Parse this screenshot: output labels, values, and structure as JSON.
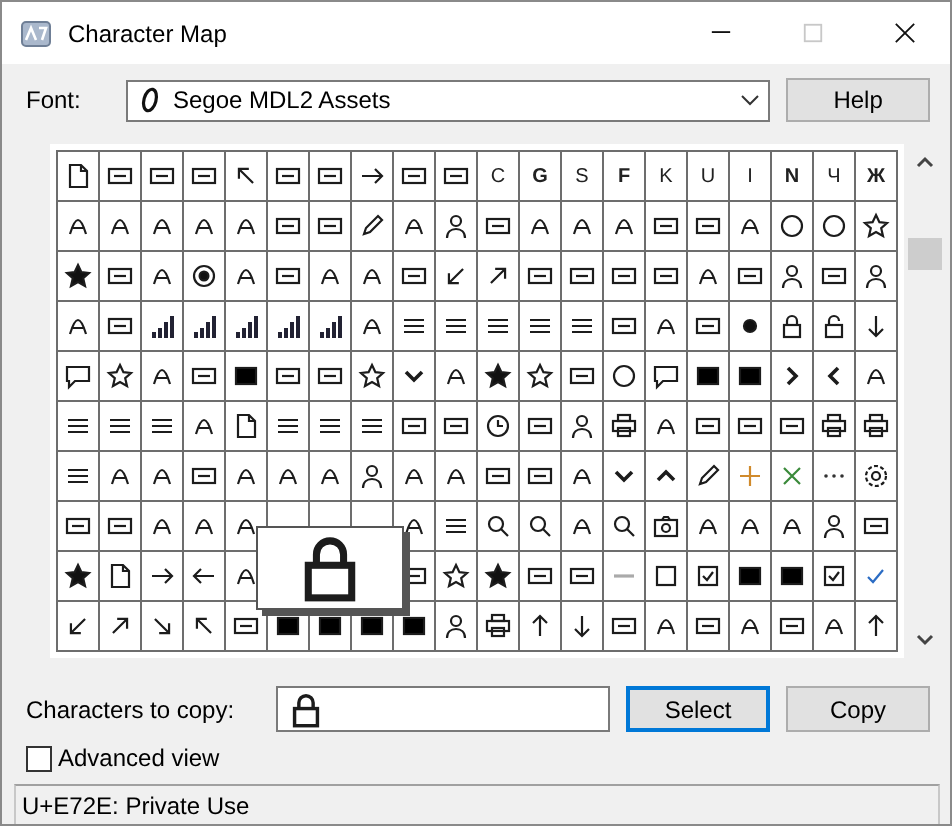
{
  "window": {
    "title": "Character Map"
  },
  "title_buttons": [
    {
      "kind": "minimize",
      "disabled": false
    },
    {
      "kind": "maximize",
      "disabled": true
    },
    {
      "kind": "close",
      "disabled": false
    }
  ],
  "font": {
    "label": "Font:",
    "value": "Segoe MDL2 Assets"
  },
  "help_button": "Help",
  "grid": {
    "rows": [
      [
        {
          "kind": "doc"
        },
        {
          "kind": "card"
        },
        {
          "kind": "card"
        },
        {
          "kind": "card"
        },
        {
          "kind": "arrow-nw"
        },
        {
          "kind": "card"
        },
        {
          "kind": "card"
        },
        {
          "kind": "arrow-e"
        },
        {
          "kind": "card"
        },
        {
          "kind": "card"
        },
        {
          "kind": "letter",
          "text": "C",
          "bold": false
        },
        {
          "kind": "letter",
          "text": "G",
          "bold": true
        },
        {
          "kind": "letter",
          "text": "S",
          "bold": false
        },
        {
          "kind": "letter",
          "text": "F",
          "bold": true
        },
        {
          "kind": "letter",
          "text": "K",
          "bold": false
        },
        {
          "kind": "letter",
          "text": "U",
          "bold": false
        },
        {
          "kind": "letter",
          "text": "I",
          "bold": false
        },
        {
          "kind": "letter",
          "text": "N",
          "bold": true
        },
        {
          "kind": "letter",
          "text": "Ч",
          "bold": false
        },
        {
          "kind": "letter",
          "text": "Ж",
          "bold": true
        }
      ],
      [
        {
          "kind": "glyph"
        },
        {
          "kind": "glyph"
        },
        {
          "kind": "glyph"
        },
        {
          "kind": "glyph"
        },
        {
          "kind": "glyph"
        },
        {
          "kind": "card"
        },
        {
          "kind": "card"
        },
        {
          "kind": "pencil"
        },
        {
          "kind": "glyph"
        },
        {
          "kind": "person"
        },
        {
          "kind": "card"
        },
        {
          "kind": "glyph"
        },
        {
          "kind": "glyph"
        },
        {
          "kind": "glyph"
        },
        {
          "kind": "card"
        },
        {
          "kind": "card"
        },
        {
          "kind": "glyph"
        },
        {
          "kind": "circle"
        },
        {
          "kind": "circle"
        },
        {
          "kind": "star-outline"
        }
      ],
      [
        {
          "kind": "star"
        },
        {
          "kind": "card"
        },
        {
          "kind": "glyph"
        },
        {
          "kind": "circle-dot"
        },
        {
          "kind": "glyph"
        },
        {
          "kind": "card"
        },
        {
          "kind": "glyph"
        },
        {
          "kind": "glyph"
        },
        {
          "kind": "card"
        },
        {
          "kind": "arrow-sw"
        },
        {
          "kind": "arrow-ne"
        },
        {
          "kind": "card"
        },
        {
          "kind": "card"
        },
        {
          "kind": "card"
        },
        {
          "kind": "card"
        },
        {
          "kind": "glyph"
        },
        {
          "kind": "card"
        },
        {
          "kind": "person"
        },
        {
          "kind": "card"
        },
        {
          "kind": "person"
        }
      ],
      [
        {
          "kind": "glyph"
        },
        {
          "kind": "card"
        },
        {
          "kind": "bars"
        },
        {
          "kind": "bars"
        },
        {
          "kind": "bars"
        },
        {
          "kind": "bars"
        },
        {
          "kind": "bars"
        },
        {
          "kind": "glyph"
        },
        {
          "kind": "lines"
        },
        {
          "kind": "lines"
        },
        {
          "kind": "lines"
        },
        {
          "kind": "lines"
        },
        {
          "kind": "lines"
        },
        {
          "kind": "card"
        },
        {
          "kind": "glyph"
        },
        {
          "kind": "card"
        },
        {
          "kind": "dot"
        },
        {
          "kind": "lock"
        },
        {
          "kind": "unlock"
        },
        {
          "kind": "arrow-s"
        }
      ],
      [
        {
          "kind": "speech"
        },
        {
          "kind": "star-outline"
        },
        {
          "kind": "glyph"
        },
        {
          "kind": "card"
        },
        {
          "kind": "square"
        },
        {
          "kind": "card"
        },
        {
          "kind": "card"
        },
        {
          "kind": "star-outline"
        },
        {
          "kind": "chevron-s"
        },
        {
          "kind": "glyph"
        },
        {
          "kind": "star"
        },
        {
          "kind": "star-outline"
        },
        {
          "kind": "card"
        },
        {
          "kind": "circle"
        },
        {
          "kind": "speech"
        },
        {
          "kind": "square"
        },
        {
          "kind": "square"
        },
        {
          "kind": "chevron-e"
        },
        {
          "kind": "chevron-w"
        },
        {
          "kind": "glyph"
        }
      ],
      [
        {
          "kind": "lines"
        },
        {
          "kind": "lines"
        },
        {
          "kind": "lines"
        },
        {
          "kind": "glyph"
        },
        {
          "kind": "doc"
        },
        {
          "kind": "lines"
        },
        {
          "kind": "lines"
        },
        {
          "kind": "lines"
        },
        {
          "kind": "card"
        },
        {
          "kind": "card"
        },
        {
          "kind": "clock"
        },
        {
          "kind": "card"
        },
        {
          "kind": "person"
        },
        {
          "kind": "printer"
        },
        {
          "kind": "glyph"
        },
        {
          "kind": "card"
        },
        {
          "kind": "card"
        },
        {
          "kind": "card"
        },
        {
          "kind": "printer"
        },
        {
          "kind": "printer"
        }
      ],
      [
        {
          "kind": "lines"
        },
        {
          "kind": "glyph"
        },
        {
          "kind": "glyph"
        },
        {
          "kind": "card"
        },
        {
          "kind": "glyph"
        },
        {
          "kind": "glyph"
        },
        {
          "kind": "glyph"
        },
        {
          "kind": "person"
        },
        {
          "kind": "glyph"
        },
        {
          "kind": "glyph"
        },
        {
          "kind": "card"
        },
        {
          "kind": "card"
        },
        {
          "kind": "glyph"
        },
        {
          "kind": "chevron-s"
        },
        {
          "kind": "chevron-n"
        },
        {
          "kind": "pencil"
        },
        {
          "kind": "plus"
        },
        {
          "kind": "cross"
        },
        {
          "kind": "dots"
        },
        {
          "kind": "gear"
        }
      ],
      [
        {
          "kind": "card"
        },
        {
          "kind": "card"
        },
        {
          "kind": "glyph"
        },
        {
          "kind": "glyph"
        },
        {
          "kind": "glyph"
        },
        {},
        {},
        {},
        {
          "kind": "glyph"
        },
        {
          "kind": "lines"
        },
        {
          "kind": "search"
        },
        {
          "kind": "search"
        },
        {
          "kind": "glyph"
        },
        {
          "kind": "search"
        },
        {
          "kind": "camera"
        },
        {
          "kind": "glyph"
        },
        {
          "kind": "glyph"
        },
        {
          "kind": "glyph"
        },
        {
          "kind": "person"
        },
        {
          "kind": "card"
        }
      ],
      [
        {
          "kind": "star"
        },
        {
          "kind": "doc"
        },
        {
          "kind": "arrow-e"
        },
        {
          "kind": "arrow-w"
        },
        {
          "kind": "glyph"
        },
        null,
        null,
        null,
        {
          "kind": "card"
        },
        {
          "kind": "star-outline"
        },
        {
          "kind": "star"
        },
        {
          "kind": "card"
        },
        {
          "kind": "card"
        },
        {
          "kind": "line"
        },
        {
          "kind": "square-outline"
        },
        {
          "kind": "checkbox"
        },
        {
          "kind": "square"
        },
        {
          "kind": "square"
        },
        {
          "kind": "checkbox"
        },
        {
          "kind": "check"
        }
      ],
      [
        {
          "kind": "arrow-sw"
        },
        {
          "kind": "arrow-ne"
        },
        {
          "kind": "arrow-se"
        },
        {
          "kind": "arrow-nw"
        },
        {
          "kind": "card"
        },
        {
          "kind": "square"
        },
        {
          "kind": "square"
        },
        {
          "kind": "square"
        },
        {
          "kind": "square"
        },
        {
          "kind": "person"
        },
        {
          "kind": "printer"
        },
        {
          "kind": "arrow-n"
        },
        {
          "kind": "arrow-s"
        },
        {
          "kind": "card"
        },
        {
          "kind": "glyph"
        },
        {
          "kind": "card"
        },
        {
          "kind": "glyph"
        },
        {
          "kind": "card"
        },
        {
          "kind": "glyph"
        },
        {
          "kind": "arrow-n"
        }
      ]
    ]
  },
  "enlarged": {
    "kind": "lock"
  },
  "copy": {
    "label": "Characters to copy:",
    "value": [
      {
        "kind": "lock"
      }
    ]
  },
  "buttons": [
    {
      "label": "Select",
      "focused": true
    },
    {
      "label": "Copy",
      "focused": false
    }
  ],
  "advanced_view": {
    "label": "Advanced view",
    "checked": false
  },
  "status_bar": "U+E72E: Private Use"
}
